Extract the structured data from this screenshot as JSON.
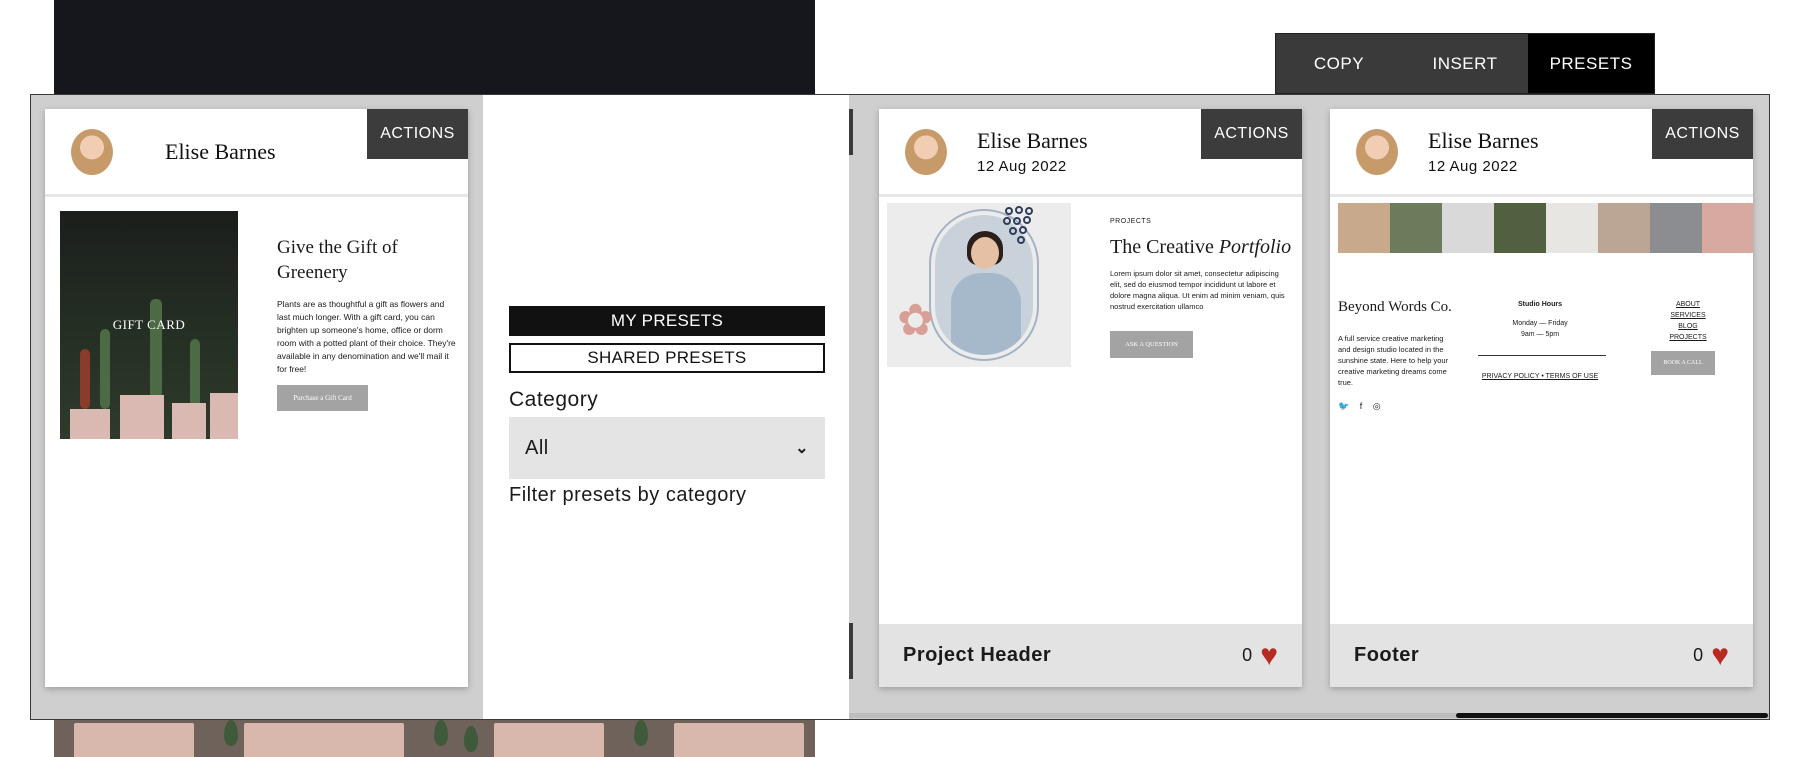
{
  "toolbar": {
    "copy_label": "COPY",
    "insert_label": "INSERT",
    "presets_label": "PRESETS"
  },
  "filters": {
    "my_presets_label": "MY PRESETS",
    "shared_presets_label": "SHARED PRESETS",
    "category_label": "Category",
    "category_value": "All",
    "category_help": "Filter presets by category"
  },
  "cards": [
    {
      "author": "Elise Barnes",
      "date": "",
      "actions_label": "ACTIONS",
      "preview": {
        "image_label": "GIFT CARD",
        "title": "Give the Gift of Greenery",
        "body": "Plants are as thoughtful a gift as flowers and last much longer. With a gift card, you can brighten up someone's home, office or dorm room with a potted plant of their choice. They're available in any denomination and we'll mail it for free!",
        "button": "Purchase a Gift Card"
      }
    },
    {
      "author": "Elise Barnes",
      "date": "12 Aug 2022",
      "actions_label": "ACTIONS",
      "title": "Project Header",
      "likes": "0",
      "preview": {
        "kicker": "PROJECTS",
        "title_plain": "The Creative",
        "title_italic": "Portfolio",
        "body": "Lorem ipsum dolor sit amet, consectetur adipiscing elit, sed do eiusmod tempor incididunt ut labore et dolore magna aliqua. Ut enim ad minim veniam, quis nostrud exercitation ullamco",
        "button": "ASK A QUESTION"
      }
    },
    {
      "author": "Elise Barnes",
      "date": "12 Aug 2022",
      "actions_label": "ACTIONS",
      "title": "Footer",
      "likes": "0",
      "preview": {
        "brand": "Beyond Words Co.",
        "description": "A full service creative marketing and design studio located in the sunshine state. Here to help your creative marketing dreams come true.",
        "social": "🐦 f ◎",
        "hours_title": "Studio Hours",
        "hours_days": "Monday — Friday",
        "hours_time": "9am — 5pm",
        "privacy": "PRIVACY POLICY",
        "separator": "•",
        "terms": "TERMS OF USE",
        "nav": [
          "ABOUT",
          "SERVICES",
          "BLOG",
          "PROJECTS"
        ],
        "button": "BOOK A CALL"
      }
    }
  ],
  "colors": {
    "heart": "#b62a22",
    "toolbar_bg": "#3a3a3a",
    "active_tab": "#000000",
    "footer_bg": "#e3e3e3"
  },
  "icons": {
    "like": "heart-icon",
    "select": "chevron-down-icon"
  }
}
